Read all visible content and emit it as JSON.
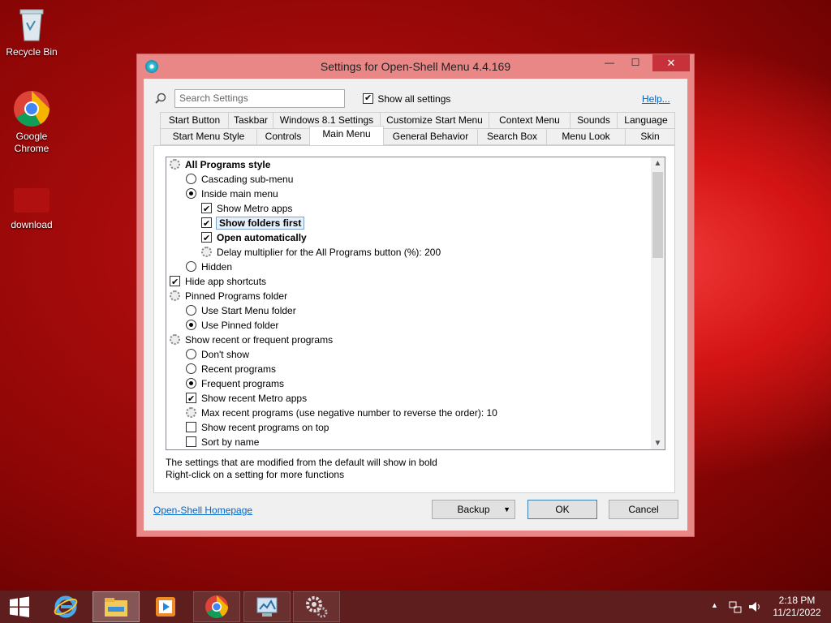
{
  "desktop": {
    "icons": [
      {
        "label": "Recycle Bin",
        "icon": "recycle-bin-icon"
      },
      {
        "label": "Google Chrome",
        "icon": "chrome-icon"
      },
      {
        "label": "download",
        "icon": "folder-image-icon"
      }
    ]
  },
  "window": {
    "title": "Settings for Open-Shell Menu 4.4.169",
    "minimize": "—",
    "maximize": "☐",
    "close": "✕"
  },
  "search": {
    "placeholder": "Search Settings",
    "show_all_label": "Show all settings",
    "show_all_checked": true,
    "help": "Help..."
  },
  "tabs": {
    "row1": [
      "Start Button",
      "Taskbar",
      "Windows 8.1 Settings",
      "Customize Start Menu",
      "Context Menu",
      "Sounds",
      "Language"
    ],
    "row2": [
      "Start Menu Style",
      "Controls",
      "Main Menu",
      "General Behavior",
      "Search Box",
      "Menu Look",
      "Skin"
    ],
    "active": "Main Menu"
  },
  "settings": [
    {
      "label": "All Programs style",
      "type": "group",
      "bold": true
    },
    {
      "label": "Cascading sub-menu",
      "type": "radio",
      "checked": false
    },
    {
      "label": "Inside main menu",
      "type": "radio",
      "checked": true
    },
    {
      "label": "Show Metro apps",
      "type": "check",
      "checked": true
    },
    {
      "label": "Show folders first",
      "type": "check",
      "checked": true,
      "bold": true,
      "selected": true
    },
    {
      "label": "Open automatically",
      "type": "check",
      "checked": true,
      "bold": true
    },
    {
      "label": "Delay multiplier for the All Programs button (%): 200",
      "type": "group"
    },
    {
      "label": "Hidden",
      "type": "radio",
      "checked": false
    },
    {
      "label": "Hide app shortcuts",
      "type": "check",
      "checked": true
    },
    {
      "label": "Pinned Programs folder",
      "type": "group"
    },
    {
      "label": "Use Start Menu folder",
      "type": "radio",
      "checked": false
    },
    {
      "label": "Use Pinned folder",
      "type": "radio",
      "checked": true
    },
    {
      "label": "Show recent or frequent programs",
      "type": "group"
    },
    {
      "label": "Don't show",
      "type": "radio",
      "checked": false
    },
    {
      "label": "Recent programs",
      "type": "radio",
      "checked": false
    },
    {
      "label": "Frequent programs",
      "type": "radio",
      "checked": true
    },
    {
      "label": "Show recent Metro apps",
      "type": "check",
      "checked": true
    },
    {
      "label": "Max recent programs (use negative number to reverse the order): 10",
      "type": "group"
    },
    {
      "label": "Show recent programs on top",
      "type": "check",
      "checked": false
    },
    {
      "label": "Sort by name",
      "type": "check",
      "checked": false
    }
  ],
  "notes": {
    "line1": "The settings that are modified from the default will show in bold",
    "line2": "Right-click on a setting for more functions"
  },
  "footer": {
    "homepage": "Open-Shell Homepage",
    "backup": "Backup",
    "ok": "OK",
    "cancel": "Cancel"
  },
  "taskbar": {
    "apps": [
      "internet-explorer-icon",
      "file-explorer-icon",
      "media-player-icon",
      "chrome-icon",
      "control-panel-icon",
      "settings-gear-icon"
    ],
    "time": "2:18 PM",
    "date": "11/21/2022"
  }
}
